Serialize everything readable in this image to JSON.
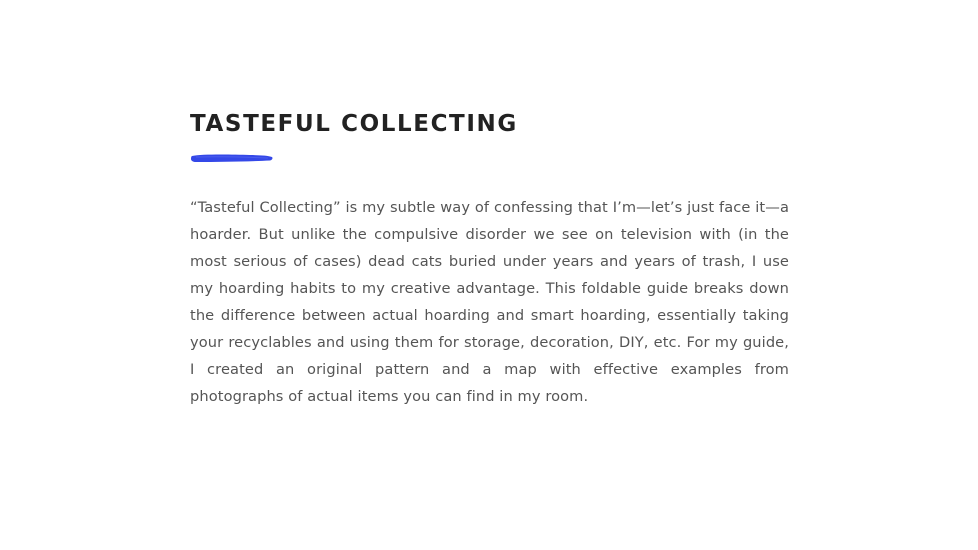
{
  "section": {
    "title": "TASTEFUL COLLECTING",
    "accent_color": "#3448e8",
    "body": "“Tasteful Collecting” is my subtle way of confessing that I’m—let’s just face it—a hoarder. But unlike the compulsive disorder we see on television with (in the most serious of cases) dead cats buried under years and years of trash, I use my hoarding habits to my creative advantage. This foldable guide breaks down the difference between actual hoarding and smart hoarding, essentially taking your recyclables and using them for storage, decoration, DIY, etc. For my guide, I created an original pattern and a map with effective examples from photographs of actual items you can find in my room."
  }
}
